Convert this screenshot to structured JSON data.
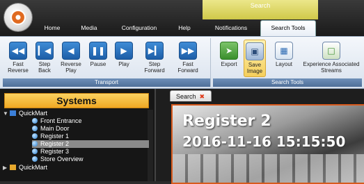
{
  "tabs": [
    {
      "label": "Home"
    },
    {
      "label": "Media"
    },
    {
      "label": "Configuration"
    },
    {
      "label": "Help"
    },
    {
      "label": "Notifications"
    },
    {
      "label": "Search Tools"
    }
  ],
  "context_tab_label": "Search",
  "ribbon": {
    "transport": {
      "caption": "Transport",
      "buttons": [
        {
          "label": "Fast Reverse",
          "icon": "fast-reverse-icon"
        },
        {
          "label": "Step Back",
          "icon": "step-back-icon"
        },
        {
          "label": "Reverse Play",
          "icon": "reverse-play-icon"
        },
        {
          "label": "Pause",
          "icon": "pause-icon"
        },
        {
          "label": "Play",
          "icon": "play-icon"
        },
        {
          "label": "Step Forward",
          "icon": "step-forward-icon"
        },
        {
          "label": "Fast Forward",
          "icon": "fast-forward-icon"
        }
      ]
    },
    "search_tools": {
      "caption": "Search Tools",
      "buttons": [
        {
          "label": "Export",
          "icon": "export-icon"
        },
        {
          "label": "Save Image",
          "icon": "save-image-icon"
        },
        {
          "label": "Layout",
          "icon": "layout-icon"
        },
        {
          "label": "Experience Associated Streams",
          "icon": "experience-streams-icon"
        }
      ]
    }
  },
  "sidebar": {
    "title": "Systems",
    "items": [
      {
        "label": "QuickMart",
        "type": "site"
      },
      {
        "label": "Front Entrance",
        "type": "camera"
      },
      {
        "label": "Main Door",
        "type": "camera"
      },
      {
        "label": "Register 1",
        "type": "camera"
      },
      {
        "label": "Register 2",
        "type": "camera",
        "selected": true
      },
      {
        "label": "Register 3",
        "type": "camera"
      },
      {
        "label": "Store Overview",
        "type": "camera"
      },
      {
        "label": "QuickMart",
        "type": "folder"
      }
    ]
  },
  "document_tab": {
    "label": "Search"
  },
  "video": {
    "camera_name": "Register 2",
    "timestamp": "2016-11-16 15:15:50"
  },
  "colors": {
    "accent_orange": "#d85a1d",
    "sidebar_header": "#f0a823",
    "context_tab": "#cfc849"
  }
}
